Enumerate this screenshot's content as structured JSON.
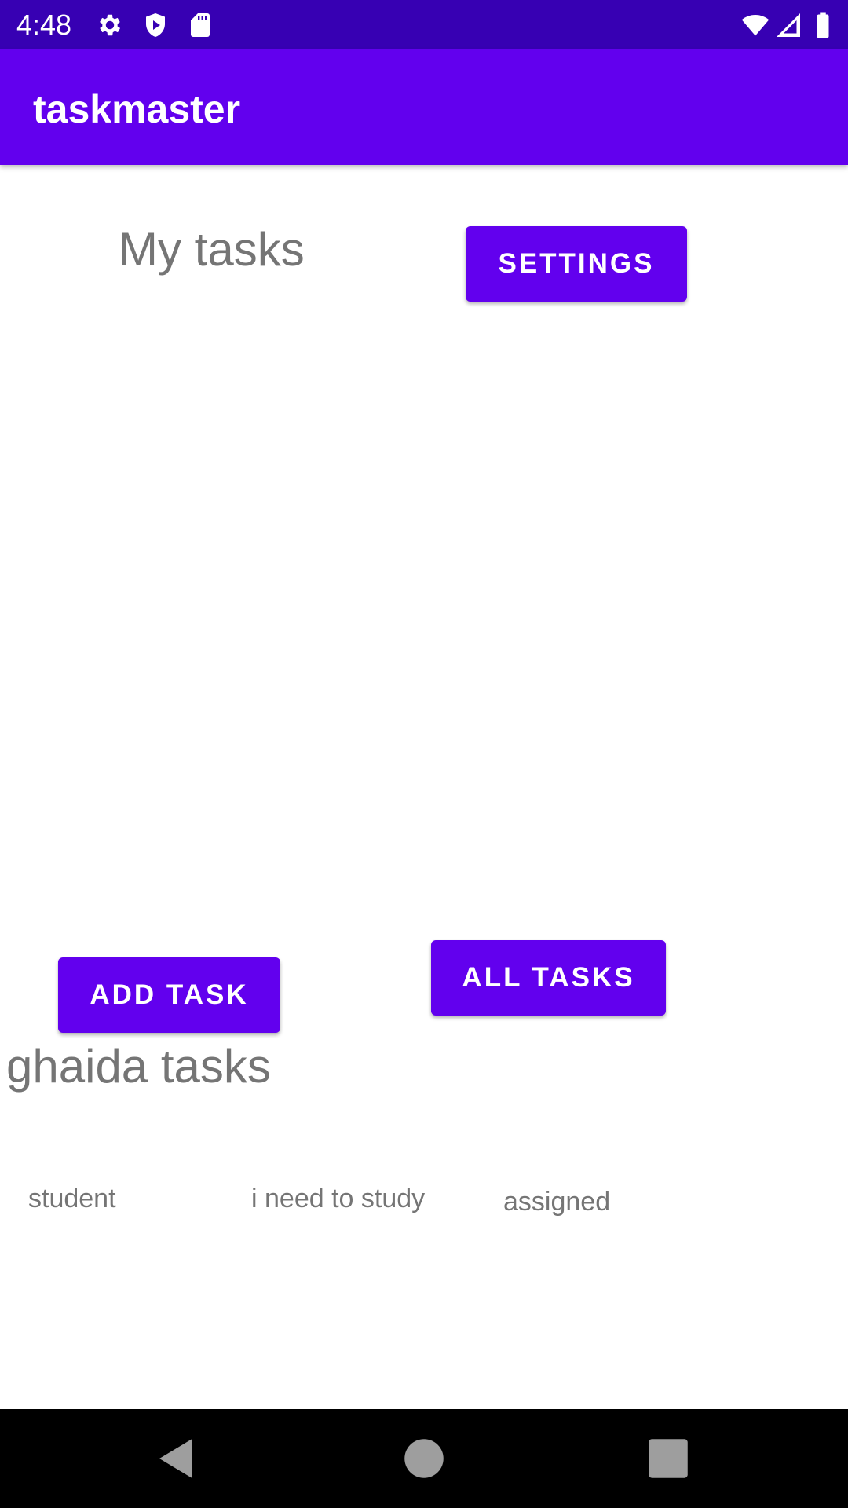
{
  "status_bar": {
    "time": "4:48",
    "left_icons": [
      "gear-icon",
      "shield-play-icon",
      "sd-card-icon"
    ],
    "right_icons": [
      "wifi-icon",
      "cell-signal-icon",
      "battery-icon"
    ],
    "color": "#3700B3"
  },
  "app_bar": {
    "title": "taskmaster",
    "color": "#6200EE"
  },
  "main": {
    "my_tasks_heading": "My tasks",
    "settings_label": "SETTINGS",
    "add_task_label": "ADD TASK",
    "all_tasks_label": "ALL TASKS",
    "user_tasks_heading": "ghaida tasks",
    "task": {
      "title": "student",
      "body": "i need to study",
      "state": "assigned"
    }
  },
  "nav_bar": {
    "icons": [
      "back-icon",
      "home-icon",
      "recents-icon"
    ]
  },
  "colors": {
    "accent": "#6200EE",
    "text_gray": "#757575"
  }
}
